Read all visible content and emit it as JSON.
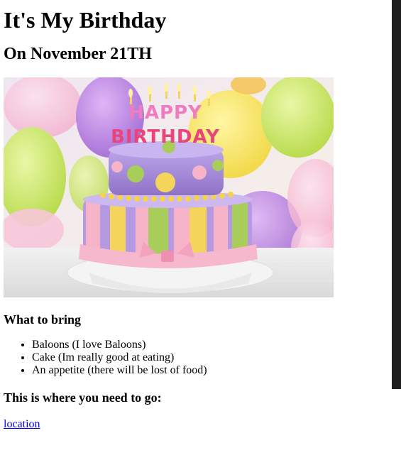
{
  "page": {
    "title": "It's My Birthday",
    "date_heading": "On November 21TH",
    "hero_image": {
      "banner_text": "HAPPY BIRTHDAY",
      "description": "birthday cake with candles and balloons"
    },
    "bring": {
      "heading": "What to bring",
      "items": [
        "Baloons (I love Baloons)",
        "Cake (Im really good at eating)",
        "An appetite (there will be lost of food)"
      ]
    },
    "destination": {
      "heading": "This is where you need to go:",
      "link_text": "location"
    }
  },
  "colors": {
    "link": "#0000ee",
    "scrollbar": "#1f1f1f",
    "cake_top": "#a98fd8",
    "cake_bottom_stripes": [
      "#f7b3c7",
      "#f4d45a",
      "#a9cd5b",
      "#b59ae3"
    ]
  }
}
